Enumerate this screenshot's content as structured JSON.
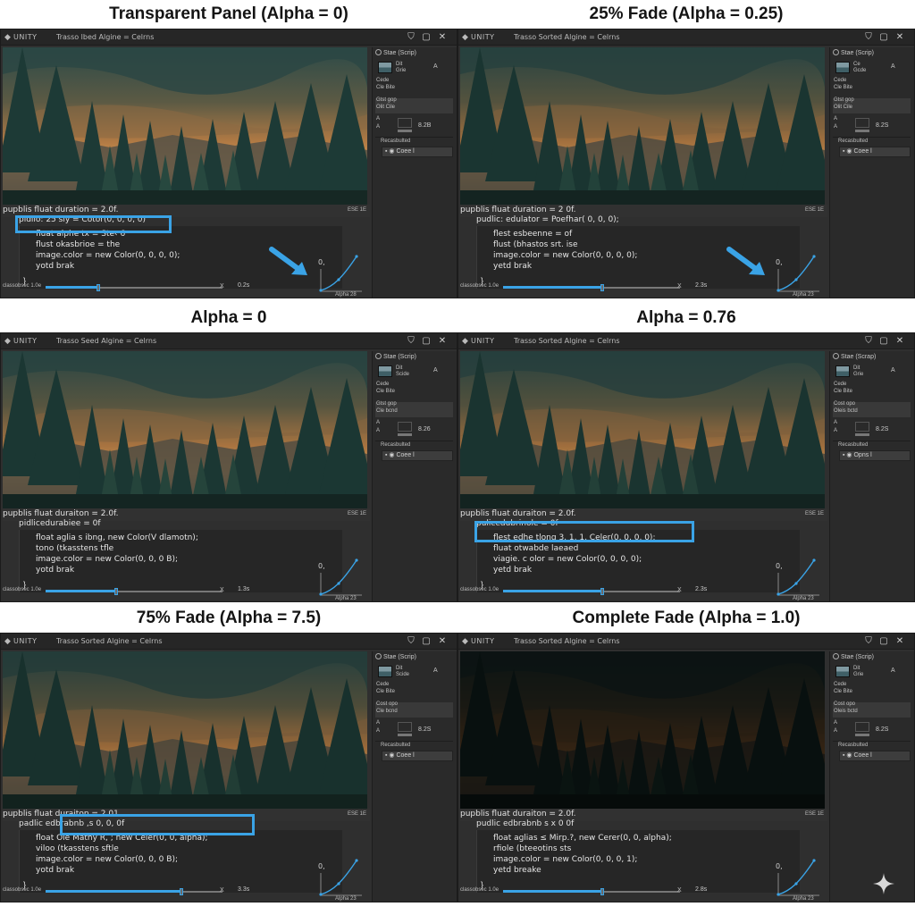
{
  "colors": {
    "accent": "#3aa3e6",
    "window_bg": "#2f2f2f",
    "editor_bg": "#262626",
    "highlight_box": "#3aa3e6"
  },
  "panels": [
    {
      "heading": "Transparent Panel (Alpha = 0)",
      "app_name": "UNITY",
      "window_title": "Trasso lbed Algine = Celrns",
      "inspector_header": "Stae (Scrip)",
      "inspector_line1": "Dit",
      "inspector_line2": "Grie",
      "inspector_a": "A",
      "inspector_l3": "Cede",
      "inspector_l4": "Cle Bite",
      "field_l1": "Gtst gop",
      "field_l2": "Olit Cile",
      "color_a1": "A",
      "color_a2": "A",
      "color_value": "8.2B",
      "section_label": "Recasbulted",
      "button_label": "Coee l",
      "code_row0": "pupblis fluat duration = 2.0f.",
      "code_row0_right": "ESE 1E",
      "code_row1": "pidlio: 25 sly = Cotor(0, 0, 0, 0)",
      "code_lines": [
        "fluat alphe tx = Ste‹ 6",
        "flust okasbrioe = the",
        "image.color = new Color(0, 0, 0, 0);",
        "yotd brak"
      ],
      "brace": "}",
      "curve_label": "0,",
      "curve_alpha": "Alpha 28",
      "timeline_label": "classobsec 1.0e",
      "timeline_x": "X",
      "timeline_time": "0.2s",
      "timeline_progress": 0.3,
      "scene_dim": 0
    },
    {
      "heading": "25% Fade (Alpha = 0.25)",
      "app_name": "UNITY",
      "window_title": "Trasso Sorted Algine = Celrns",
      "inspector_header": "Stae (Scrip)",
      "inspector_line1": "Ce",
      "inspector_line2": "Gcde",
      "inspector_a": "A",
      "inspector_l3": "Cede",
      "inspector_l4": "Cle Bite",
      "field_l1": "Gtst gop",
      "field_l2": "Olit Cile",
      "color_a1": "A",
      "color_a2": "A",
      "color_value": "8.2S",
      "section_label": "Recasbulted",
      "button_label": "Coee l",
      "code_row0": "pupblis fluat duration = 2 0f.",
      "code_row0_right": "ESE 1E",
      "code_row1": "pudlic: edulator = Poefhar( 0, 0, 0);",
      "code_lines": [
        "flest esbeenne = of",
        "flust (bhastos srt. ise",
        "image.color = new Color(0, 0, 0, 0);",
        "yetd brak"
      ],
      "brace": "}",
      "curve_label": "0,",
      "curve_alpha": "Alpha 23",
      "timeline_label": "classobsec 1.0e",
      "timeline_x": "X",
      "timeline_time": "2.3s",
      "timeline_progress": 0.56,
      "scene_dim": 0.08
    },
    {
      "heading": "Alpha = 0",
      "app_name": "UNITY",
      "window_title": "Trasso Seed Algine = Celrns",
      "inspector_header": "Stae (Scrip)",
      "inspector_line1": "Dit",
      "inspector_line2": "Scide",
      "inspector_a": "A",
      "inspector_l3": "Cede",
      "inspector_l4": "Cle Bite",
      "field_l1": "Gtst gop",
      "field_l2": "Cle bcnd",
      "color_a1": "A",
      "color_a2": "A",
      "color_value": "8.26",
      "section_label": "Recasbulted",
      "button_label": "Coee l",
      "code_row0": "pupblis fluat duraiton = 2.0f.",
      "code_row0_right": "ESE 1E",
      "code_row1": "pidlicedurabiee = 0f",
      "code_lines": [
        "float aglia s ibng, new Color(V dlamotn);",
        "tono (tkasstens tfle",
        "image.color = new Color(0, 0, 0 B);",
        "yotd brak"
      ],
      "brace": "}",
      "curve_label": "0,",
      "curve_alpha": "Alpha 23",
      "timeline_label": "classobsec 1.0e",
      "timeline_x": "X",
      "timeline_time": "1.3s",
      "timeline_progress": 0.4,
      "scene_dim": 0.05
    },
    {
      "heading": "Alpha = 0.76",
      "app_name": "UNITY",
      "window_title": "Trasso Sorted Algine = Celrns",
      "inspector_header": "Stae (Scrap)",
      "inspector_line1": "Dit",
      "inspector_line2": "Grie",
      "inspector_a": "A",
      "inspector_l3": "Cede",
      "inspector_l4": "Cle Bite",
      "field_l1": "Cost opo",
      "field_l2": "Oleis bctd",
      "color_a1": "A",
      "color_a2": "A",
      "color_value": "8.2S",
      "section_label": "Recasbulted",
      "button_label": "Opns l",
      "code_row0": "pupblis fluat duraiton = 2.0f.",
      "code_row0_right": "ESE 1E",
      "code_row1": "pulicedubrinole = 0f",
      "code_lines": [
        "flest edhe tlong 3, 1, 1, Celer(0, 0, 0, 0);",
        "fluat otwabde laeaed",
        "viagie. c olor = new Color(0, 0, 0, 0);",
        "yetd brak"
      ],
      "brace": "}",
      "curve_label": "0,",
      "curve_alpha": "Alpha 23",
      "timeline_label": "classobsec 1.0e",
      "timeline_x": "X",
      "timeline_time": "2.3s",
      "timeline_progress": 0.56,
      "scene_dim": 0.1
    },
    {
      "heading": "75% Fade (Alpha = 7.5)",
      "app_name": "UNITY",
      "window_title": "Trasso Sorted Algine = Celrns",
      "inspector_header": "Stae (Scrip)",
      "inspector_line1": "Dit",
      "inspector_line2": "Scide",
      "inspector_a": "A",
      "inspector_l3": "Cede",
      "inspector_l4": "Cle Bite",
      "field_l1": "Cost opo",
      "field_l2": "Cle bcnd",
      "color_a1": "A",
      "color_a2": "A",
      "color_value": "8.2S",
      "section_label": "Recasbulted",
      "button_label": "Coee l",
      "code_row0": "pupblis fluat duraiton = 2.01",
      "code_row0_right": "ESE 1E",
      "code_row1": "padlic edbrabnb ,s 0, 0, 0f",
      "code_lines": [
        "float Ole Mathy R, ; new Celer(0, 0, alpha);",
        "viloo (tkasstens sftle",
        "image.color = new Color(0, 0, 0 B);",
        "yotd brak"
      ],
      "brace": "}",
      "curve_label": "0,",
      "curve_alpha": "Alpha 23",
      "timeline_label": "classobsec 1.0e",
      "timeline_x": "X",
      "timeline_time": "3.3s",
      "timeline_progress": 0.77,
      "scene_dim": 0.15
    },
    {
      "heading": "Complete Fade (Alpha = 1.0)",
      "app_name": "UNITY",
      "window_title": "Trasso Sorted Algine = Celrns",
      "inspector_header": "Stae (Scrip)",
      "inspector_line1": "Dit",
      "inspector_line2": "Grie",
      "inspector_a": "A",
      "inspector_l3": "Cede",
      "inspector_l4": "Cle Bite",
      "field_l1": "Cost opo",
      "field_l2": "Oleis bctd",
      "color_a1": "A",
      "color_a2": "A",
      "color_value": "8.2S",
      "section_label": "Recasbulted",
      "button_label": "Coee l",
      "code_row0": "pupblis fluat duraiton = 2.0f.",
      "code_row0_right": "ESE 1E",
      "code_row1": "pudlic edbrabnb s x 0 0f",
      "code_lines": [
        "float aglias ≤ Mirp.?, new Cerer(0, 0, alpha);",
        "rfiole (bteeotins sts",
        "image.color = new Color(0, 0, 0, 1);",
        "yetd breake"
      ],
      "brace": "}",
      "curve_label": "0,",
      "curve_alpha": "Alpha 23",
      "timeline_label": "classobsec 1.0e",
      "timeline_x": "X",
      "timeline_time": "2.8s",
      "timeline_progress": 0.56,
      "scene_dim": 0.72
    }
  ]
}
